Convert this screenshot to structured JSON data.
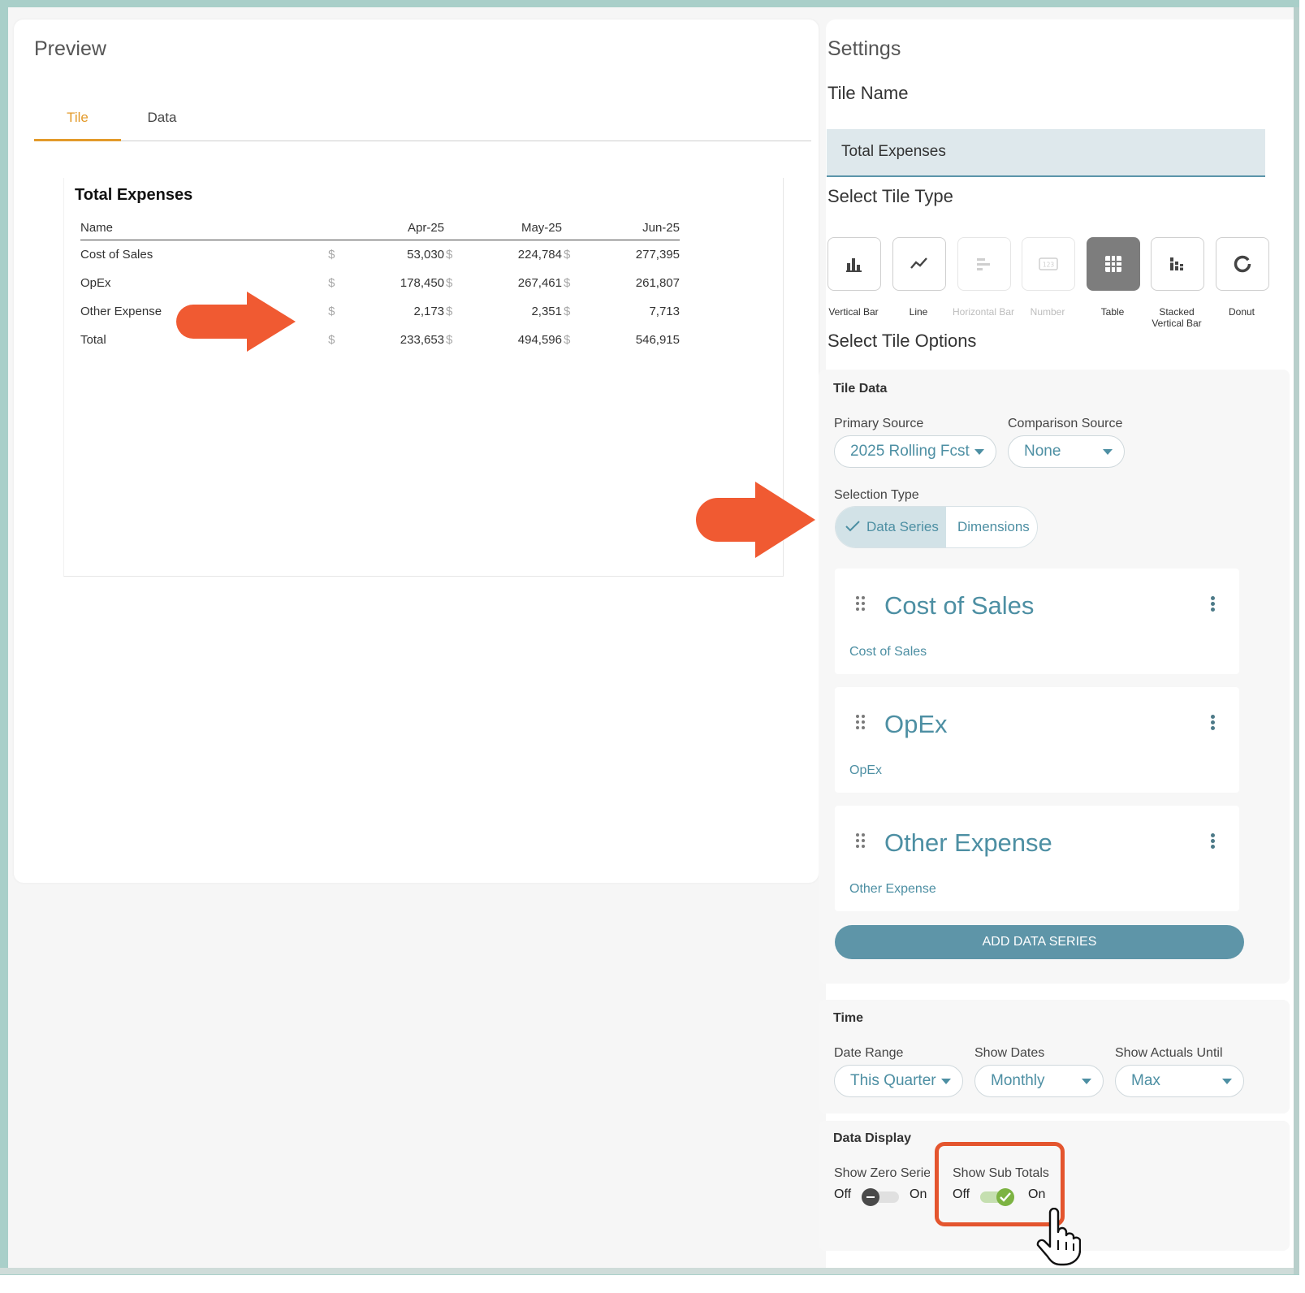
{
  "preview": {
    "title": "Preview",
    "tabs": [
      "Tile",
      "Data"
    ],
    "active_tab": "Tile",
    "tile": {
      "title": "Total Expenses",
      "columns": [
        "Name",
        "Apr-25",
        "May-25",
        "Jun-25"
      ],
      "currency_symbol": "$",
      "rows": [
        {
          "name": "Cost of Sales",
          "values": [
            "53,030",
            "224,784",
            "277,395"
          ]
        },
        {
          "name": "OpEx",
          "values": [
            "178,450",
            "267,461",
            "261,807"
          ]
        },
        {
          "name": "Other Expense",
          "values": [
            "2,173",
            "2,351",
            "7,713"
          ]
        },
        {
          "name": "Total",
          "values": [
            "233,653",
            "494,596",
            "546,915"
          ]
        }
      ]
    }
  },
  "settings": {
    "title": "Settings",
    "tile_name_label": "Tile Name",
    "tile_name_value": "Total Expenses",
    "tile_type_label": "Select Tile Type",
    "tile_types": [
      {
        "label": "Vertical Bar",
        "icon": "vertical-bar-icon",
        "state": "enabled"
      },
      {
        "label": "Line",
        "icon": "line-chart-icon",
        "state": "enabled"
      },
      {
        "label": "Horizontal Bar",
        "icon": "horizontal-bar-icon",
        "state": "disabled"
      },
      {
        "label": "Number",
        "icon": "number-icon",
        "state": "disabled"
      },
      {
        "label": "Table",
        "icon": "table-icon",
        "state": "selected"
      },
      {
        "label": "Stacked Vertical Bar",
        "icon": "stacked-bar-icon",
        "state": "enabled"
      },
      {
        "label": "Donut",
        "icon": "donut-icon",
        "state": "enabled"
      }
    ],
    "tile_options_label": "Select Tile Options",
    "tile_data": {
      "title": "Tile Data",
      "primary_source_label": "Primary Source",
      "primary_source_value": "2025 Rolling Fcst",
      "comparison_source_label": "Comparison Source",
      "comparison_source_value": "None",
      "selection_type_label": "Selection Type",
      "selection_types": [
        "Data Series",
        "Dimensions"
      ],
      "selected_type": "Data Series",
      "series": [
        {
          "title": "Cost of Sales",
          "subtitle": "Cost of Sales"
        },
        {
          "title": "OpEx",
          "subtitle": "OpEx"
        },
        {
          "title": "Other Expense",
          "subtitle": "Other Expense"
        }
      ],
      "add_button": "ADD DATA SERIES"
    },
    "time": {
      "title": "Time",
      "date_range_label": "Date Range",
      "date_range_value": "This Quarter",
      "show_dates_label": "Show Dates",
      "show_dates_value": "Monthly",
      "show_actuals_label": "Show Actuals Until",
      "show_actuals_value": "Max"
    },
    "data_display": {
      "title": "Data Display",
      "show_zero_series_label": "Show Zero Series",
      "show_zero_series_on": false,
      "show_sub_totals_label": "Show Sub Totals",
      "show_sub_totals_on": true,
      "off_label": "Off",
      "on_label": "On"
    }
  },
  "colors": {
    "accent_orange": "#e39a2a",
    "teal": "#4d8fa3",
    "button_teal": "#5e95a8",
    "annotation_orange": "#f05a32",
    "toggle_on": "#7cb342"
  }
}
